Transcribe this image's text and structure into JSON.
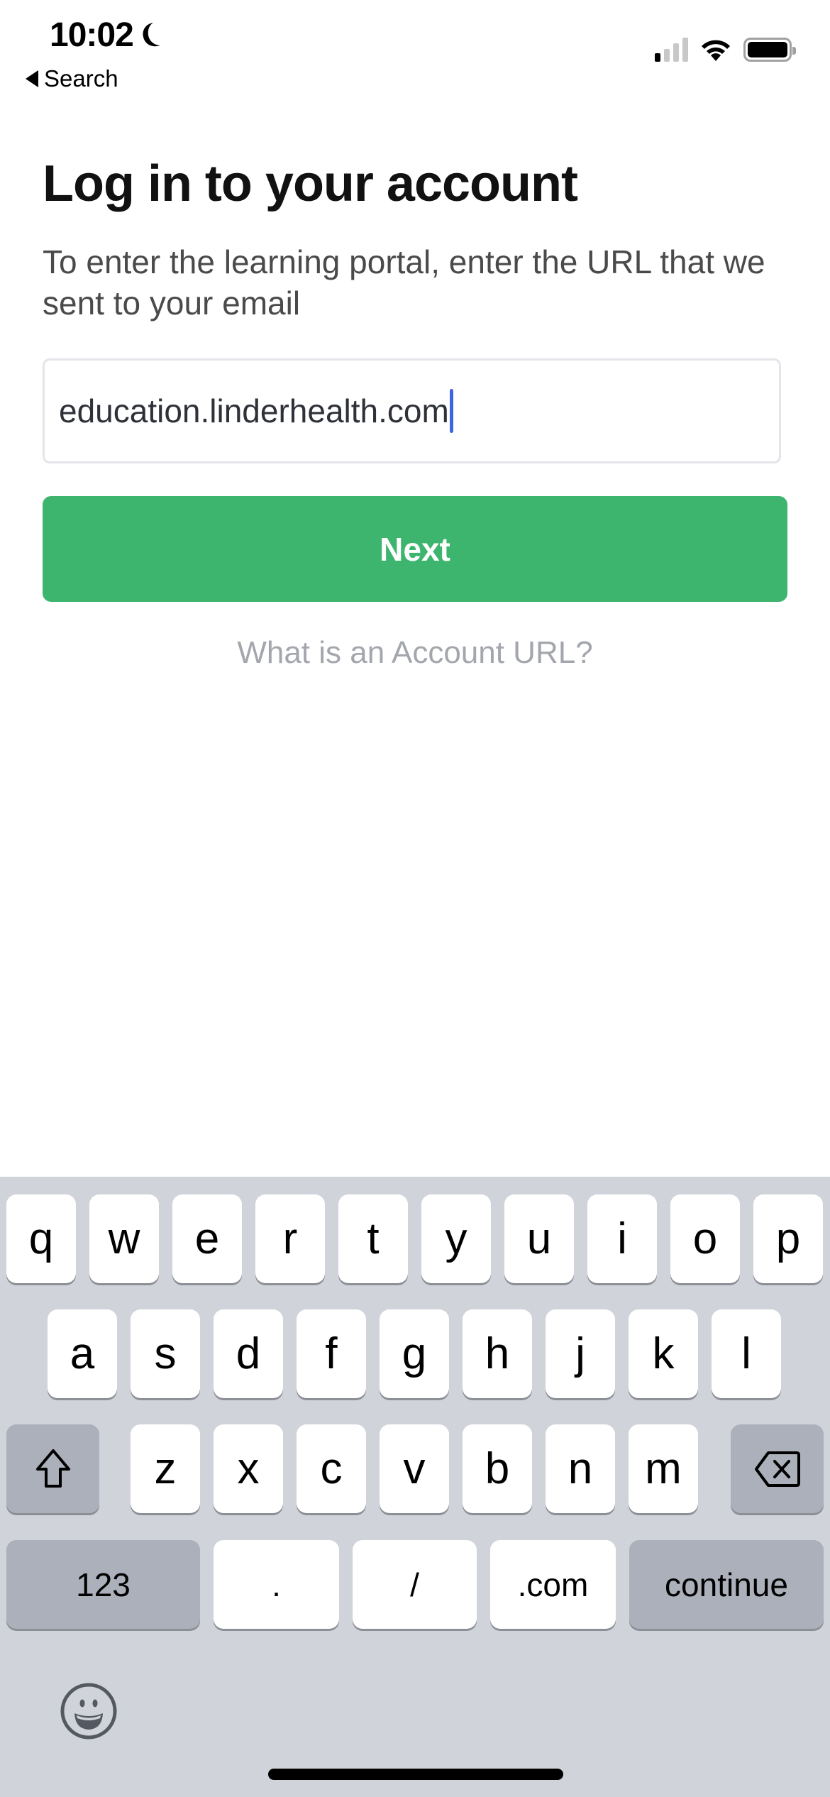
{
  "status_bar": {
    "time": "10:02",
    "focus_icon": "moon-icon",
    "back_label": "Search",
    "signal_bars_active": 1,
    "signal_bars_total": 4,
    "battery_level": 1.0
  },
  "page": {
    "title": "Log in to your account",
    "subtitle": "To enter the learning portal, enter the URL that we sent to your email",
    "url_input": {
      "value": "education.linderhealth.com",
      "focused": true
    },
    "next_button": "Next",
    "help_link": "What is an Account URL?",
    "accent_color": "#3db56e",
    "caret_color": "#3e64e6"
  },
  "keyboard": {
    "row1": [
      "q",
      "w",
      "e",
      "r",
      "t",
      "y",
      "u",
      "i",
      "o",
      "p"
    ],
    "row2": [
      "a",
      "s",
      "d",
      "f",
      "g",
      "h",
      "j",
      "k",
      "l"
    ],
    "row3": [
      "z",
      "x",
      "c",
      "v",
      "b",
      "n",
      "m"
    ],
    "shift_icon": "shift-icon",
    "delete_icon": "delete-icon",
    "numbers_key": "123",
    "dot_key": ".",
    "slash_key": "/",
    "dotcom_key": ".com",
    "return_key": "continue",
    "emoji_icon": "emoji-icon"
  }
}
